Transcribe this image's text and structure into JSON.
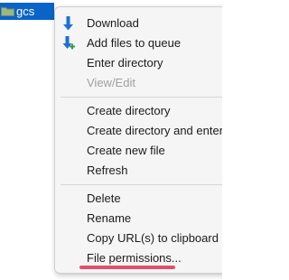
{
  "selected_file": {
    "name": "gcs",
    "icon": "folder-icon"
  },
  "menu": {
    "items": [
      {
        "label": "Download",
        "icon": "download-arrow-icon",
        "enabled": true
      },
      {
        "label": "Add files to queue",
        "icon": "add-to-queue-icon",
        "enabled": true
      },
      {
        "label": "Enter directory",
        "enabled": true
      },
      {
        "label": "View/Edit",
        "enabled": false
      },
      {
        "label": "Create directory",
        "enabled": true
      },
      {
        "label": "Create directory and enter i",
        "enabled": true
      },
      {
        "label": "Create new file",
        "enabled": true
      },
      {
        "label": "Refresh",
        "enabled": true
      },
      {
        "label": "Delete",
        "enabled": true
      },
      {
        "label": "Rename",
        "enabled": true
      },
      {
        "label": "Copy URL(s) to clipboard",
        "enabled": true
      },
      {
        "label": "File permissions...",
        "enabled": true,
        "highlighted": true
      }
    ]
  },
  "colors": {
    "selection": "#0a64c8",
    "menu_bg": "#f5f5f5",
    "disabled_text": "#a0a0a0",
    "focus_underline": "#e0506e"
  }
}
